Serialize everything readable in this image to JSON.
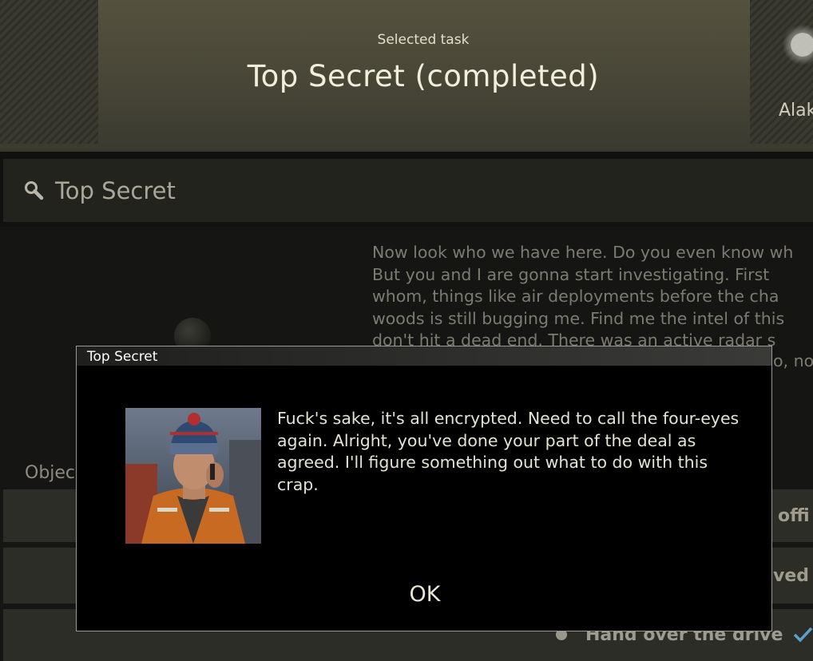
{
  "header": {
    "selected_label": "Selected task",
    "task_title": "Top Secret (completed)",
    "trader_name": "Alak"
  },
  "search": {
    "value": "Top Secret"
  },
  "briefing": {
    "lines": [
      "Now look who we have here. Do you even know wh",
      "But you and I are gonna start investigating. First",
      "whom, things like air deployments before the cha",
      "woods is still bugging me. Find me the intel of this",
      "don't hit a dead end. There was an active radar s"
    ],
    "tail": "o, not"
  },
  "objectives": {
    "label": "Objec",
    "rows": [
      {
        "text": "offi"
      },
      {
        "text": "ved f"
      },
      {
        "text": "Hand over the drive"
      }
    ]
  },
  "dialog": {
    "title": "Top Secret",
    "message": "Fuck's sake, it's all encrypted. Need to call the four-eyes again. Alright, you've done your part of the deal as agreed. I'll figure something out what to do with this crap.",
    "ok_label": "OK"
  },
  "colors": {
    "header_bg": "#4a4838",
    "dialog_bg": "#000000",
    "accent_check": "#5aa0c8"
  }
}
